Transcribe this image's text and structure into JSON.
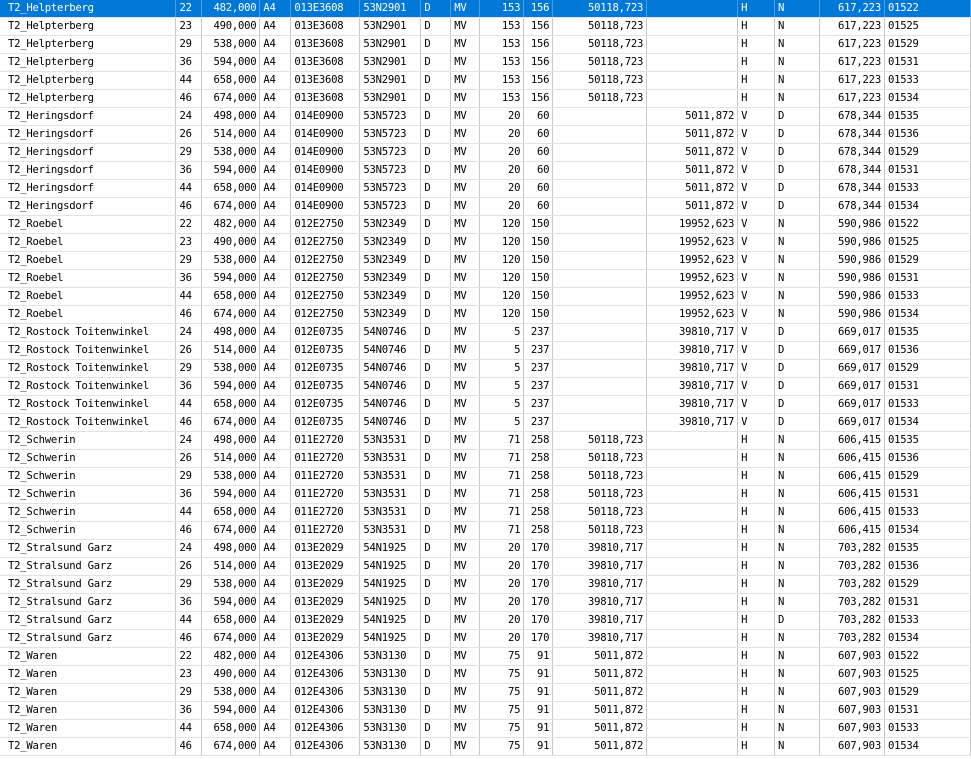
{
  "table": {
    "selected_row": 0,
    "rows": [
      [
        "T2_Helpterberg",
        "22",
        "482,000",
        "A4",
        "013E3608",
        "53N2901",
        "D",
        "MV",
        "153",
        "156",
        "50118,723",
        "",
        "H",
        "N",
        "617,223",
        "01522"
      ],
      [
        "T2_Helpterberg",
        "23",
        "490,000",
        "A4",
        "013E3608",
        "53N2901",
        "D",
        "MV",
        "153",
        "156",
        "50118,723",
        "",
        "H",
        "N",
        "617,223",
        "01525"
      ],
      [
        "T2_Helpterberg",
        "29",
        "538,000",
        "A4",
        "013E3608",
        "53N2901",
        "D",
        "MV",
        "153",
        "156",
        "50118,723",
        "",
        "H",
        "N",
        "617,223",
        "01529"
      ],
      [
        "T2_Helpterberg",
        "36",
        "594,000",
        "A4",
        "013E3608",
        "53N2901",
        "D",
        "MV",
        "153",
        "156",
        "50118,723",
        "",
        "H",
        "N",
        "617,223",
        "01531"
      ],
      [
        "T2_Helpterberg",
        "44",
        "658,000",
        "A4",
        "013E3608",
        "53N2901",
        "D",
        "MV",
        "153",
        "156",
        "50118,723",
        "",
        "H",
        "N",
        "617,223",
        "01533"
      ],
      [
        "T2_Helpterberg",
        "46",
        "674,000",
        "A4",
        "013E3608",
        "53N2901",
        "D",
        "MV",
        "153",
        "156",
        "50118,723",
        "",
        "H",
        "N",
        "617,223",
        "01534"
      ],
      [
        "T2_Heringsdorf",
        "24",
        "498,000",
        "A4",
        "014E0900",
        "53N5723",
        "D",
        "MV",
        "20",
        "60",
        "",
        "5011,872",
        "V",
        "D",
        "678,344",
        "01535"
      ],
      [
        "T2_Heringsdorf",
        "26",
        "514,000",
        "A4",
        "014E0900",
        "53N5723",
        "D",
        "MV",
        "20",
        "60",
        "",
        "5011,872",
        "V",
        "D",
        "678,344",
        "01536"
      ],
      [
        "T2_Heringsdorf",
        "29",
        "538,000",
        "A4",
        "014E0900",
        "53N5723",
        "D",
        "MV",
        "20",
        "60",
        "",
        "5011,872",
        "V",
        "D",
        "678,344",
        "01529"
      ],
      [
        "T2_Heringsdorf",
        "36",
        "594,000",
        "A4",
        "014E0900",
        "53N5723",
        "D",
        "MV",
        "20",
        "60",
        "",
        "5011,872",
        "V",
        "D",
        "678,344",
        "01531"
      ],
      [
        "T2_Heringsdorf",
        "44",
        "658,000",
        "A4",
        "014E0900",
        "53N5723",
        "D",
        "MV",
        "20",
        "60",
        "",
        "5011,872",
        "V",
        "D",
        "678,344",
        "01533"
      ],
      [
        "T2_Heringsdorf",
        "46",
        "674,000",
        "A4",
        "014E0900",
        "53N5723",
        "D",
        "MV",
        "20",
        "60",
        "",
        "5011,872",
        "V",
        "D",
        "678,344",
        "01534"
      ],
      [
        "T2_Roebel",
        "22",
        "482,000",
        "A4",
        "012E2750",
        "53N2349",
        "D",
        "MV",
        "120",
        "150",
        "",
        "19952,623",
        "V",
        "N",
        "590,986",
        "01522"
      ],
      [
        "T2_Roebel",
        "23",
        "490,000",
        "A4",
        "012E2750",
        "53N2349",
        "D",
        "MV",
        "120",
        "150",
        "",
        "19952,623",
        "V",
        "N",
        "590,986",
        "01525"
      ],
      [
        "T2_Roebel",
        "29",
        "538,000",
        "A4",
        "012E2750",
        "53N2349",
        "D",
        "MV",
        "120",
        "150",
        "",
        "19952,623",
        "V",
        "N",
        "590,986",
        "01529"
      ],
      [
        "T2_Roebel",
        "36",
        "594,000",
        "A4",
        "012E2750",
        "53N2349",
        "D",
        "MV",
        "120",
        "150",
        "",
        "19952,623",
        "V",
        "N",
        "590,986",
        "01531"
      ],
      [
        "T2_Roebel",
        "44",
        "658,000",
        "A4",
        "012E2750",
        "53N2349",
        "D",
        "MV",
        "120",
        "150",
        "",
        "19952,623",
        "V",
        "N",
        "590,986",
        "01533"
      ],
      [
        "T2_Roebel",
        "46",
        "674,000",
        "A4",
        "012E2750",
        "53N2349",
        "D",
        "MV",
        "120",
        "150",
        "",
        "19952,623",
        "V",
        "N",
        "590,986",
        "01534"
      ],
      [
        "T2_Rostock Toitenwinkel",
        "24",
        "498,000",
        "A4",
        "012E0735",
        "54N0746",
        "D",
        "MV",
        "5",
        "237",
        "",
        "39810,717",
        "V",
        "D",
        "669,017",
        "01535"
      ],
      [
        "T2_Rostock Toitenwinkel",
        "26",
        "514,000",
        "A4",
        "012E0735",
        "54N0746",
        "D",
        "MV",
        "5",
        "237",
        "",
        "39810,717",
        "V",
        "D",
        "669,017",
        "01536"
      ],
      [
        "T2_Rostock Toitenwinkel",
        "29",
        "538,000",
        "A4",
        "012E0735",
        "54N0746",
        "D",
        "MV",
        "5",
        "237",
        "",
        "39810,717",
        "V",
        "D",
        "669,017",
        "01529"
      ],
      [
        "T2_Rostock Toitenwinkel",
        "36",
        "594,000",
        "A4",
        "012E0735",
        "54N0746",
        "D",
        "MV",
        "5",
        "237",
        "",
        "39810,717",
        "V",
        "D",
        "669,017",
        "01531"
      ],
      [
        "T2_Rostock Toitenwinkel",
        "44",
        "658,000",
        "A4",
        "012E0735",
        "54N0746",
        "D",
        "MV",
        "5",
        "237",
        "",
        "39810,717",
        "V",
        "D",
        "669,017",
        "01533"
      ],
      [
        "T2_Rostock Toitenwinkel",
        "46",
        "674,000",
        "A4",
        "012E0735",
        "54N0746",
        "D",
        "MV",
        "5",
        "237",
        "",
        "39810,717",
        "V",
        "D",
        "669,017",
        "01534"
      ],
      [
        "T2_Schwerin",
        "24",
        "498,000",
        "A4",
        "011E2720",
        "53N3531",
        "D",
        "MV",
        "71",
        "258",
        "50118,723",
        "",
        "H",
        "N",
        "606,415",
        "01535"
      ],
      [
        "T2_Schwerin",
        "26",
        "514,000",
        "A4",
        "011E2720",
        "53N3531",
        "D",
        "MV",
        "71",
        "258",
        "50118,723",
        "",
        "H",
        "N",
        "606,415",
        "01536"
      ],
      [
        "T2_Schwerin",
        "29",
        "538,000",
        "A4",
        "011E2720",
        "53N3531",
        "D",
        "MV",
        "71",
        "258",
        "50118,723",
        "",
        "H",
        "N",
        "606,415",
        "01529"
      ],
      [
        "T2_Schwerin",
        "36",
        "594,000",
        "A4",
        "011E2720",
        "53N3531",
        "D",
        "MV",
        "71",
        "258",
        "50118,723",
        "",
        "H",
        "N",
        "606,415",
        "01531"
      ],
      [
        "T2_Schwerin",
        "44",
        "658,000",
        "A4",
        "011E2720",
        "53N3531",
        "D",
        "MV",
        "71",
        "258",
        "50118,723",
        "",
        "H",
        "N",
        "606,415",
        "01533"
      ],
      [
        "T2_Schwerin",
        "46",
        "674,000",
        "A4",
        "011E2720",
        "53N3531",
        "D",
        "MV",
        "71",
        "258",
        "50118,723",
        "",
        "H",
        "N",
        "606,415",
        "01534"
      ],
      [
        "T2_Stralsund Garz",
        "24",
        "498,000",
        "A4",
        "013E2029",
        "54N1925",
        "D",
        "MV",
        "20",
        "170",
        "39810,717",
        "",
        "H",
        "N",
        "703,282",
        "01535"
      ],
      [
        "T2_Stralsund Garz",
        "26",
        "514,000",
        "A4",
        "013E2029",
        "54N1925",
        "D",
        "MV",
        "20",
        "170",
        "39810,717",
        "",
        "H",
        "N",
        "703,282",
        "01536"
      ],
      [
        "T2_Stralsund Garz",
        "29",
        "538,000",
        "A4",
        "013E2029",
        "54N1925",
        "D",
        "MV",
        "20",
        "170",
        "39810,717",
        "",
        "H",
        "N",
        "703,282",
        "01529"
      ],
      [
        "T2_Stralsund Garz",
        "36",
        "594,000",
        "A4",
        "013E2029",
        "54N1925",
        "D",
        "MV",
        "20",
        "170",
        "39810,717",
        "",
        "H",
        "N",
        "703,282",
        "01531"
      ],
      [
        "T2_Stralsund Garz",
        "44",
        "658,000",
        "A4",
        "013E2029",
        "54N1925",
        "D",
        "MV",
        "20",
        "170",
        "39810,717",
        "",
        "H",
        "D",
        "703,282",
        "01533"
      ],
      [
        "T2_Stralsund Garz",
        "46",
        "674,000",
        "A4",
        "013E2029",
        "54N1925",
        "D",
        "MV",
        "20",
        "170",
        "39810,717",
        "",
        "H",
        "N",
        "703,282",
        "01534"
      ],
      [
        "T2_Waren",
        "22",
        "482,000",
        "A4",
        "012E4306",
        "53N3130",
        "D",
        "MV",
        "75",
        "91",
        "5011,872",
        "",
        "H",
        "N",
        "607,903",
        "01522"
      ],
      [
        "T2_Waren",
        "23",
        "490,000",
        "A4",
        "012E4306",
        "53N3130",
        "D",
        "MV",
        "75",
        "91",
        "5011,872",
        "",
        "H",
        "N",
        "607,903",
        "01525"
      ],
      [
        "T2_Waren",
        "29",
        "538,000",
        "A4",
        "012E4306",
        "53N3130",
        "D",
        "MV",
        "75",
        "91",
        "5011,872",
        "",
        "H",
        "N",
        "607,903",
        "01529"
      ],
      [
        "T2_Waren",
        "36",
        "594,000",
        "A4",
        "012E4306",
        "53N3130",
        "D",
        "MV",
        "75",
        "91",
        "5011,872",
        "",
        "H",
        "N",
        "607,903",
        "01531"
      ],
      [
        "T2_Waren",
        "44",
        "658,000",
        "A4",
        "012E4306",
        "53N3130",
        "D",
        "MV",
        "75",
        "91",
        "5011,872",
        "",
        "H",
        "N",
        "607,903",
        "01533"
      ],
      [
        "T2_Waren",
        "46",
        "674,000",
        "A4",
        "012E4306",
        "53N3130",
        "D",
        "MV",
        "75",
        "91",
        "5011,872",
        "",
        "H",
        "N",
        "607,903",
        "01534"
      ]
    ]
  }
}
